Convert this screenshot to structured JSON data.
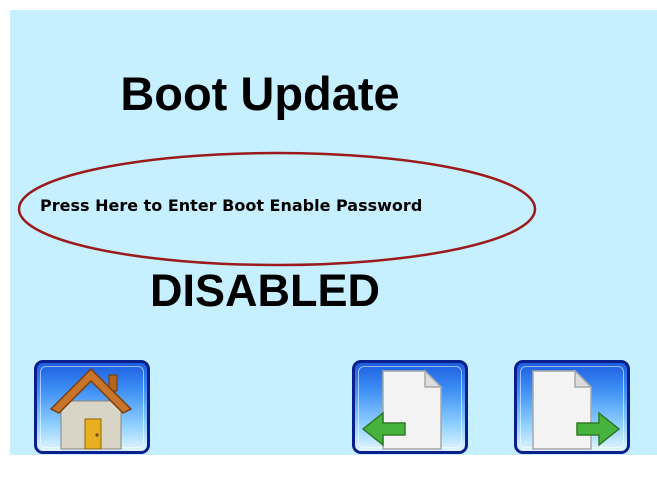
{
  "screen": {
    "title": "Boot Update",
    "password_prompt": "Press Here to Enter Boot Enable Password",
    "status": "DISABLED"
  },
  "icons": {
    "home": "home-icon",
    "back": "back-page-icon",
    "forward": "forward-page-icon"
  },
  "colors": {
    "background": "#c6efff",
    "highlight_ellipse": "#9b1b1b",
    "button_border": "#0a1e8c",
    "arrow_green": "#46b43c"
  }
}
